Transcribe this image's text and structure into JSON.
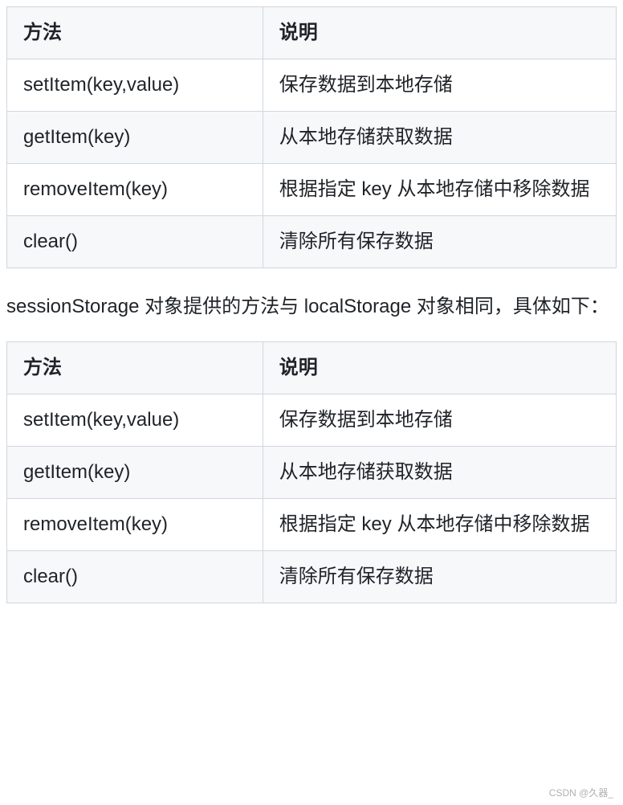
{
  "table1": {
    "headers": {
      "method": "方法",
      "desc": "说明"
    },
    "rows": [
      {
        "method": "setItem(key,value)",
        "desc": "保存数据到本地存储"
      },
      {
        "method": "getItem(key)",
        "desc": "从本地存储获取数据"
      },
      {
        "method": "removeItem(key)",
        "desc": "根据指定 key 从本地存储中移除数据"
      },
      {
        "method": "clear()",
        "desc": "清除所有保存数据"
      }
    ]
  },
  "paragraph1": "sessionStorage 对象提供的方法与 localStorage 对象相同，具体如下：",
  "table2": {
    "headers": {
      "method": "方法",
      "desc": "说明"
    },
    "rows": [
      {
        "method": "setItem(key,value)",
        "desc": "保存数据到本地存储"
      },
      {
        "method": "getItem(key)",
        "desc": "从本地存储获取数据"
      },
      {
        "method": "removeItem(key)",
        "desc": "根据指定 key 从本地存储中移除数据"
      },
      {
        "method": "clear()",
        "desc": "清除所有保存数据"
      }
    ]
  },
  "watermark": "CSDN @久器_"
}
